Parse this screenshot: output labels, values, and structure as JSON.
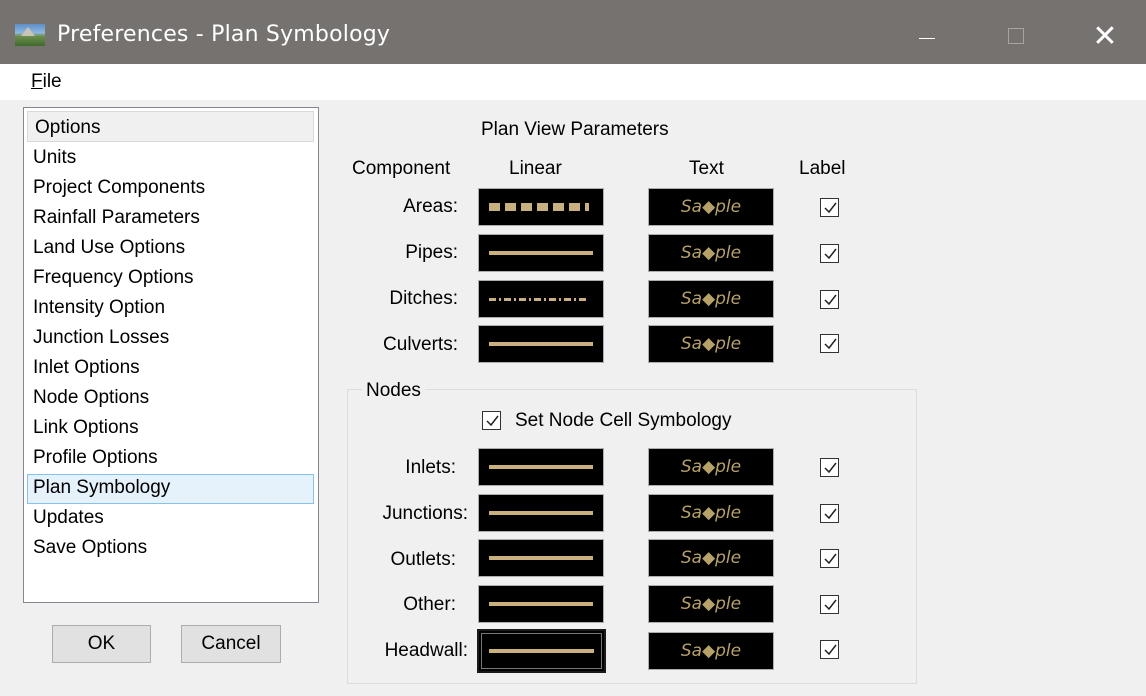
{
  "window": {
    "title": "Preferences - Plan Symbology",
    "icon": "app-landscape-icon"
  },
  "menu": {
    "file": "File"
  },
  "options": {
    "header": "Options",
    "items": [
      "Units",
      "Project Components",
      "Rainfall Parameters",
      "Land Use Options",
      "Frequency Options",
      "Intensity Option",
      "Junction Losses",
      "Inlet Options",
      "Node Options",
      "Link Options",
      "Profile Options",
      "Plan Symbology",
      "Updates",
      "Save Options"
    ],
    "selected": "Plan Symbology"
  },
  "buttons": {
    "ok": "OK",
    "cancel": "Cancel"
  },
  "plan": {
    "title": "Plan View Parameters",
    "headers": {
      "component": "Component",
      "linear": "Linear",
      "text": "Text",
      "label": "Label"
    },
    "rows": [
      {
        "label": "Areas:",
        "line_style": "dashed",
        "sample": "Sa◆ple",
        "checked": true
      },
      {
        "label": "Pipes:",
        "line_style": "solid",
        "sample": "Sa◆ple",
        "checked": true
      },
      {
        "label": "Ditches:",
        "line_style": "dash-dot",
        "sample": "Sa◆ple",
        "checked": true
      },
      {
        "label": "Culverts:",
        "line_style": "solid",
        "sample": "Sa◆ple",
        "checked": true
      }
    ]
  },
  "nodes": {
    "legend": "Nodes",
    "set_node_cell": {
      "label": "Set Node Cell Symbology",
      "checked": true
    },
    "rows": [
      {
        "label": "Inlets:",
        "line_style": "solid",
        "sample": "Sa◆ple",
        "checked": true
      },
      {
        "label": "Junctions:",
        "line_style": "solid",
        "sample": "Sa◆ple",
        "checked": true
      },
      {
        "label": "Outlets:",
        "line_style": "solid",
        "sample": "Sa◆ple",
        "checked": true
      },
      {
        "label": "Other:",
        "line_style": "solid",
        "sample": "Sa◆ple",
        "checked": true
      },
      {
        "label": "Headwall:",
        "line_style": "solid",
        "sample": "Sa◆ple",
        "checked": true
      }
    ]
  },
  "colors": {
    "titlebar": "#767270",
    "line": "#c9b07e",
    "sample_text": "#b7a16a",
    "selected_item": "#e6f2fb"
  }
}
